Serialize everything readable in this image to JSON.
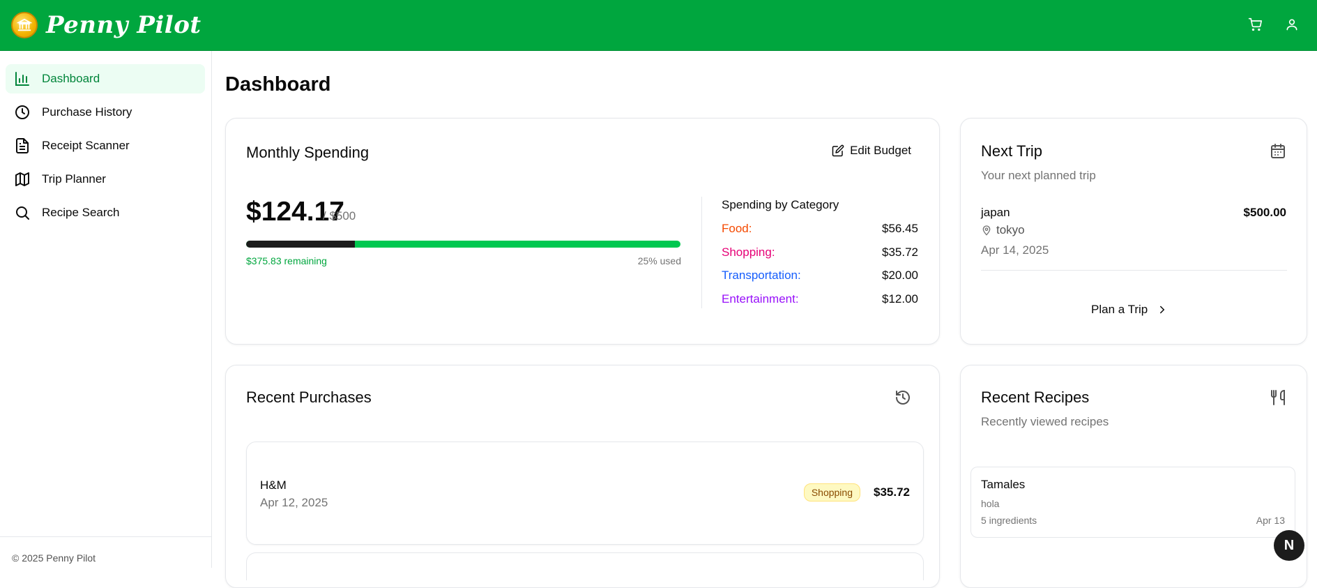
{
  "app": {
    "name": "Penny Pilot",
    "colors": {
      "brand": "#00a63e",
      "accent_green": "#00c850"
    }
  },
  "header": {
    "icons": [
      "coin-logo-icon",
      "cart-icon",
      "user-icon"
    ]
  },
  "sidebar": {
    "items": [
      {
        "label": "Dashboard",
        "icon": "bar-chart-icon",
        "active": true
      },
      {
        "label": "Purchase History",
        "icon": "clock-icon",
        "active": false
      },
      {
        "label": "Receipt Scanner",
        "icon": "document-icon",
        "active": false
      },
      {
        "label": "Trip Planner",
        "icon": "map-icon",
        "active": false
      },
      {
        "label": "Recipe Search",
        "icon": "search-icon",
        "active": false
      }
    ],
    "footer": "© 2025 Penny Pilot"
  },
  "main": {
    "title": "Dashboard",
    "monthly_spending": {
      "title": "Monthly Spending",
      "edit_label": "Edit Budget",
      "amount": "$124.17",
      "limit": "/ $500",
      "used_fraction": 0.25,
      "remaining": "$375.83 remaining",
      "used": "25% used",
      "categories_title": "Spending by Category",
      "categories": [
        {
          "name": "Food:",
          "value": "$56.45",
          "color": "#f54900"
        },
        {
          "name": "Shopping:",
          "value": "$35.72",
          "color": "#e60076"
        },
        {
          "name": "Transportation:",
          "value": "$20.00",
          "color": "#155dfc"
        },
        {
          "name": "Entertainment:",
          "value": "$12.00",
          "color": "#9810fa"
        }
      ]
    },
    "next_trip": {
      "title": "Next Trip",
      "subtitle": "Your next planned trip",
      "destination": "japan",
      "city": "tokyo",
      "date": "Apr 14, 2025",
      "budget": "$500.00",
      "plan_label": "Plan a Trip"
    },
    "recent_purchases": {
      "title": "Recent Purchases",
      "items": [
        {
          "store": "H&M",
          "date": "Apr 12, 2025",
          "category": "Shopping",
          "amount": "$35.72"
        }
      ]
    },
    "recent_recipes": {
      "title": "Recent Recipes",
      "subtitle": "Recently viewed recipes",
      "items": [
        {
          "name": "Tamales",
          "note": "hola",
          "ingredients": "5 ingredients",
          "date": "Apr 13"
        }
      ]
    }
  },
  "dev_badge": "N"
}
